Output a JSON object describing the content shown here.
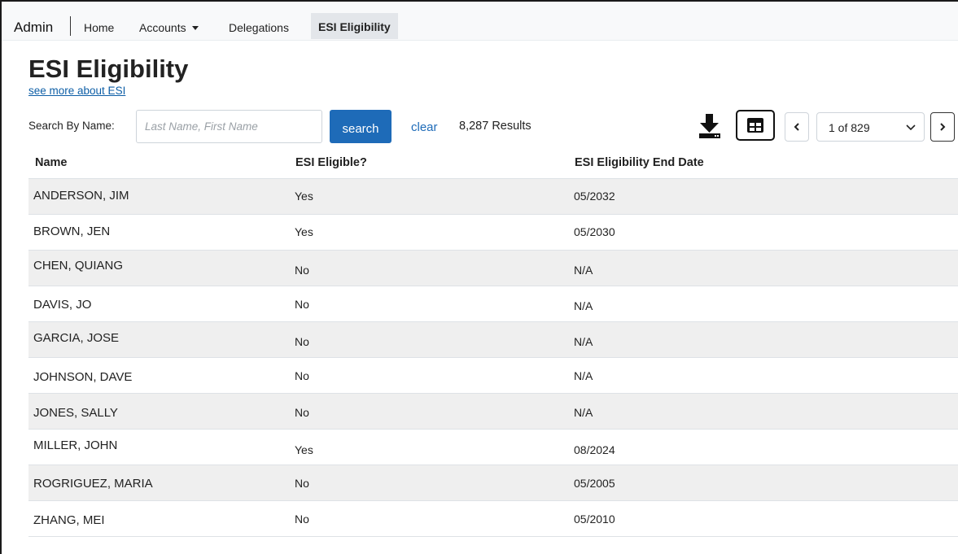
{
  "nav": {
    "brand": "Admin",
    "items": [
      {
        "label": "Home"
      },
      {
        "label": "Accounts"
      },
      {
        "label": "Delegations"
      },
      {
        "label": "ESI Eligibility"
      }
    ]
  },
  "page": {
    "title": "ESI Eligibility",
    "more_link": "see more about ESI"
  },
  "search": {
    "label": "Search By Name:",
    "placeholder": "Last Name, First Name",
    "value": "",
    "button_label": "search",
    "clear_label": "clear",
    "results_text": "8,287 Results"
  },
  "toolbar": {
    "download_icon": "download-icon",
    "grid_icon": "table-grid-icon",
    "page_select": "1 of 829",
    "prev_icon": "chevron-left-icon",
    "next_icon": "chevron-right-icon"
  },
  "table": {
    "headers": [
      "Name",
      "ESI Eligible?",
      "ESI Eligibility End Date"
    ],
    "rows": [
      {
        "name": "ANDERSON, JIM",
        "eligible": "Yes",
        "end_date": "05/2032"
      },
      {
        "name": "BROWN, JEN",
        "eligible": "Yes",
        "end_date": "05/2030"
      },
      {
        "name": "CHEN, QUIANG",
        "eligible": "No",
        "end_date": "N/A"
      },
      {
        "name": "DAVIS, JO",
        "eligible": "No",
        "end_date": "N/A"
      },
      {
        "name": "GARCIA, JOSE",
        "eligible": "No",
        "end_date": "N/A"
      },
      {
        "name": "JOHNSON, DAVE",
        "eligible": "No",
        "end_date": "N/A"
      },
      {
        "name": "JONES, SALLY",
        "eligible": "No",
        "end_date": "N/A"
      },
      {
        "name": "MILLER, JOHN",
        "eligible": "Yes",
        "end_date": "08/2024"
      },
      {
        "name": "ROGRIGUEZ, MARIA",
        "eligible": "No",
        "end_date": "05/2005"
      },
      {
        "name": "ZHANG, MEI",
        "eligible": "No",
        "end_date": "05/2010"
      }
    ]
  },
  "colors": {
    "primary": "#1e6bb8",
    "link": "#0d5ea6",
    "stripe": "#efefef"
  }
}
